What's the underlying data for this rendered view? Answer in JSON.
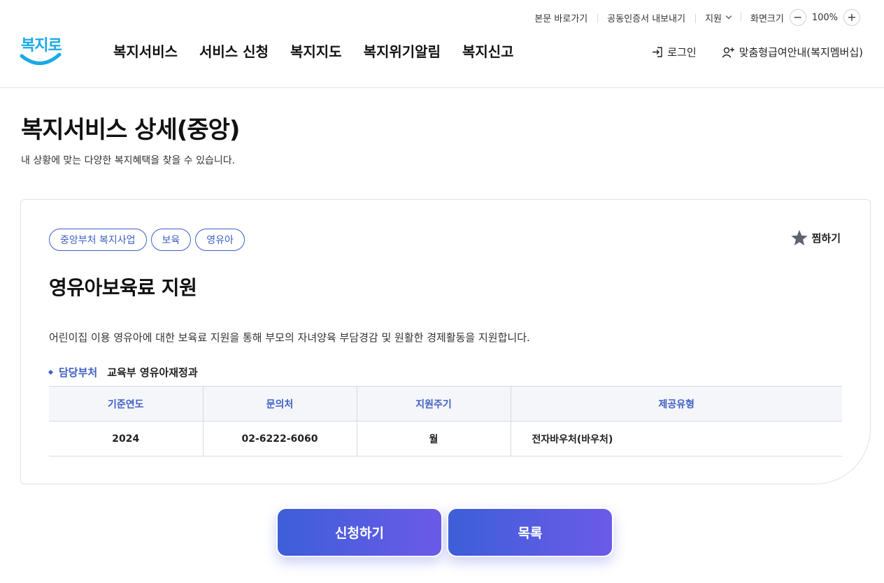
{
  "utility": {
    "skip_link": "본문 바로가기",
    "cert_export": "공동인증서 내보내기",
    "support": "지원",
    "screen_size_label": "화면크기",
    "zoom_minus": "−",
    "zoom_value": "100%",
    "zoom_plus": "+"
  },
  "logo": {
    "text": "복지로",
    "icon": "bokjiro-logo"
  },
  "nav": {
    "items": [
      "복지서비스",
      "서비스 신청",
      "복지지도",
      "복지위기알림",
      "복지신고"
    ]
  },
  "header_right": {
    "login": "로그인",
    "login_icon": "login-icon",
    "membership": "맞춤형급여안내(복지멤버십)",
    "membership_icon": "user-add-icon"
  },
  "page": {
    "title": "복지서비스 상세(중앙)",
    "description": "내 상황에 맞는 다양한 복지혜택을 찾을 수 있습니다."
  },
  "service": {
    "tags": [
      "중앙부처 복지사업",
      "보육",
      "영유아"
    ],
    "favorite_label": "찜하기",
    "title": "영유아보육료 지원",
    "description": "어린이집 이용 영유아에 대한 보육료 지원을 통해 부모의 자녀양육 부담경감 및 원활한 경제활동을 지원합니다.",
    "dept_label": "담당부처",
    "dept_value": "교육부 영유아재정과",
    "table": {
      "headers": [
        "기준연도",
        "문의처",
        "지원주기",
        "제공유형"
      ],
      "row": [
        "2024",
        "02-6222-6060",
        "월",
        "전자바우처(바우처)"
      ]
    }
  },
  "buttons": {
    "apply": "신청하기",
    "list": "목록"
  },
  "colors": {
    "accent": "#3e5fc4",
    "button_start": "#3d5fd8",
    "button_end": "#6b5ae8",
    "logo_blue": "#1aa9e8"
  }
}
